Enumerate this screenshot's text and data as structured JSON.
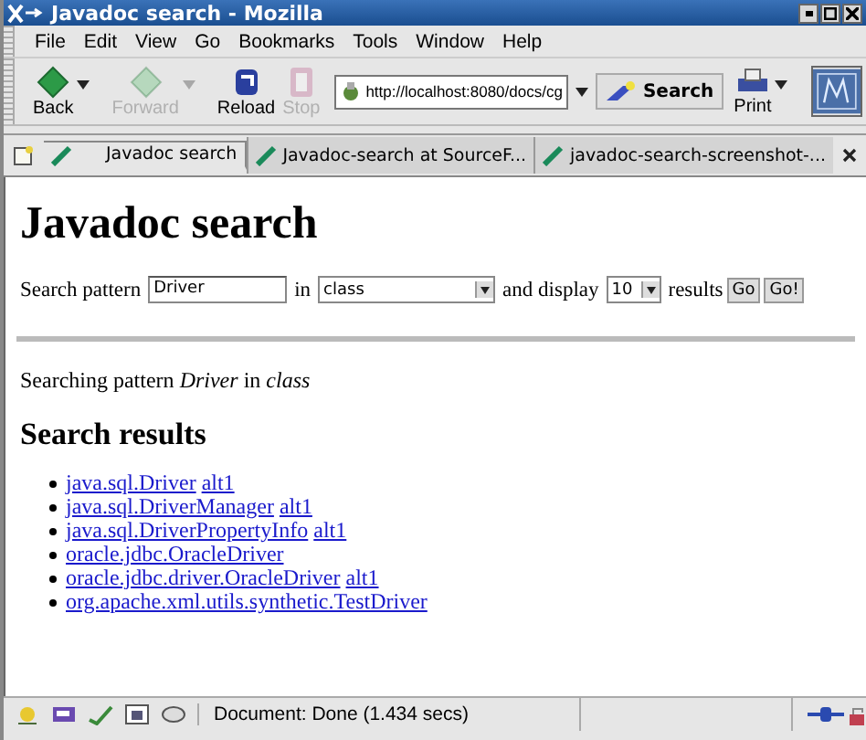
{
  "window": {
    "title": "Javadoc search - Mozilla"
  },
  "menu": [
    "File",
    "Edit",
    "View",
    "Go",
    "Bookmarks",
    "Tools",
    "Window",
    "Help"
  ],
  "toolbar": [
    {
      "kind": "back",
      "label": "Back",
      "disabled": false,
      "dropdown": true
    },
    {
      "kind": "forward",
      "label": "Forward",
      "disabled": true,
      "dropdown": true
    },
    {
      "kind": "reload",
      "label": "Reload",
      "disabled": false,
      "dropdown": false
    },
    {
      "kind": "stop",
      "label": "Stop",
      "disabled": true,
      "dropdown": false
    }
  ],
  "url": "http://localhost:8080/docs/cg",
  "search_button": "Search",
  "print_button": "Print",
  "tabs": [
    {
      "label": "Javadoc search",
      "selected": true
    },
    {
      "label": "Javadoc-search at SourceF...",
      "selected": false
    },
    {
      "label": "javadoc-search-screenshot-...",
      "selected": false
    }
  ],
  "page": {
    "heading": "Javadoc search",
    "form": {
      "pattern_label": "Search pattern",
      "pattern_value": "Driver",
      "in_label": "in",
      "scope": "class",
      "display_label": "and display",
      "count": "10",
      "results_label": "results",
      "buttons": [
        "Go",
        "Go!"
      ]
    },
    "summary": "Searching pattern *Driver* in *class*",
    "results_heading": "Search results",
    "results": [
      {
        "name": "java.sql.Driver",
        "alt": "alt1"
      },
      {
        "name": "java.sql.DriverManager",
        "alt": "alt1"
      },
      {
        "name": "java.sql.DriverPropertyInfo",
        "alt": "alt1"
      },
      {
        "name": "oracle.jdbc.OracleDriver"
      },
      {
        "name": "oracle.jdbc.driver.OracleDriver",
        "alt": "alt1"
      },
      {
        "name": "org.apache.xml.utils.synthetic.TestDriver"
      }
    ]
  },
  "status_bar": {
    "text": "Document: Done (1.434 secs)"
  }
}
